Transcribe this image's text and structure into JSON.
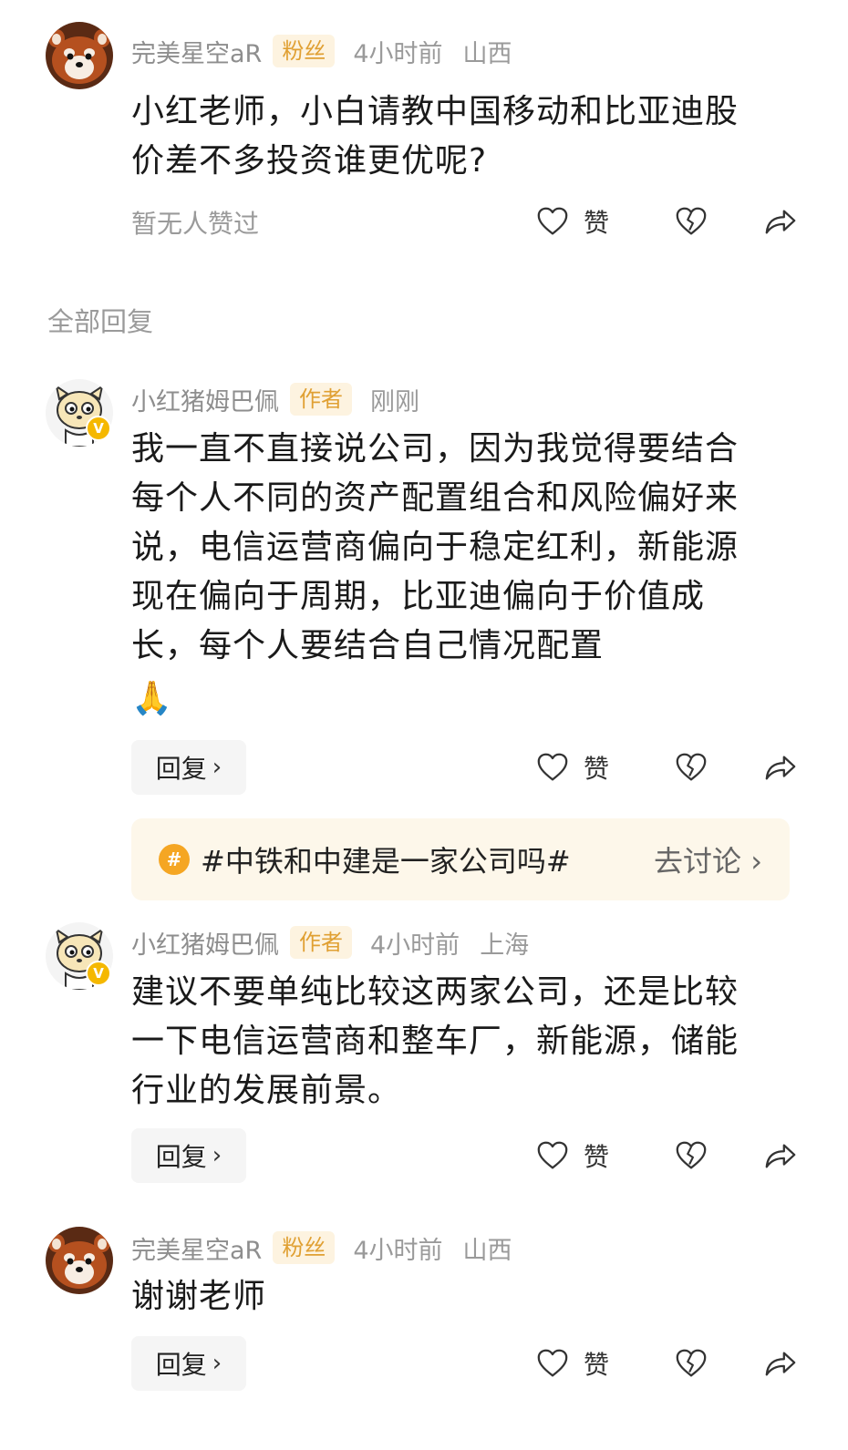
{
  "comments": [
    {
      "name": "完美星空aR",
      "badge": "粉丝",
      "time": "4小时前",
      "location": "山西",
      "text": "小红老师，小白请教中国移动和比亚迪股价差不多投资谁更优呢?",
      "no_likes": "暂无人赞过",
      "like_label": "赞"
    }
  ],
  "section_title": "全部回复",
  "replies": [
    {
      "name": "小红猪姆巴佩",
      "badge": "作者",
      "time": "刚刚",
      "location": "",
      "text": "我一直不直接说公司，因为我觉得要结合每个人不同的资产配置组合和风险偏好来说，电信运营商偏向于稳定红利，新能源现在偏向于周期，比亚迪偏向于价值成长，每个人要结合自己情况配置",
      "emoji": "🙏",
      "reply_label": "回复",
      "like_label": "赞"
    },
    {
      "name": "小红猪姆巴佩",
      "badge": "作者",
      "time": "4小时前",
      "location": "上海",
      "text": "建议不要单纯比较这两家公司，还是比较一下电信运营商和整车厂，新能源，储能行业的发展前景。",
      "reply_label": "回复",
      "like_label": "赞"
    },
    {
      "name": "完美星空aR",
      "badge": "粉丝",
      "time": "4小时前",
      "location": "山西",
      "text": "谢谢老师",
      "reply_label": "回复",
      "like_label": "赞"
    }
  ],
  "topic": {
    "icon": "#",
    "text": "#中铁和中建是一家公司吗#",
    "action": "去讨论 ›"
  },
  "verified_mark": "V",
  "chevron": "›",
  "icons": [
    "heart-icon",
    "broken-heart-icon",
    "share-icon",
    "red-panda-avatar",
    "cartoon-animal-avatar"
  ],
  "colors": {
    "badge_bg": "#fdf3e0",
    "badge_text": "#e0a033",
    "topic_bg": "#fdf7ea",
    "verified": "#f5b800"
  }
}
